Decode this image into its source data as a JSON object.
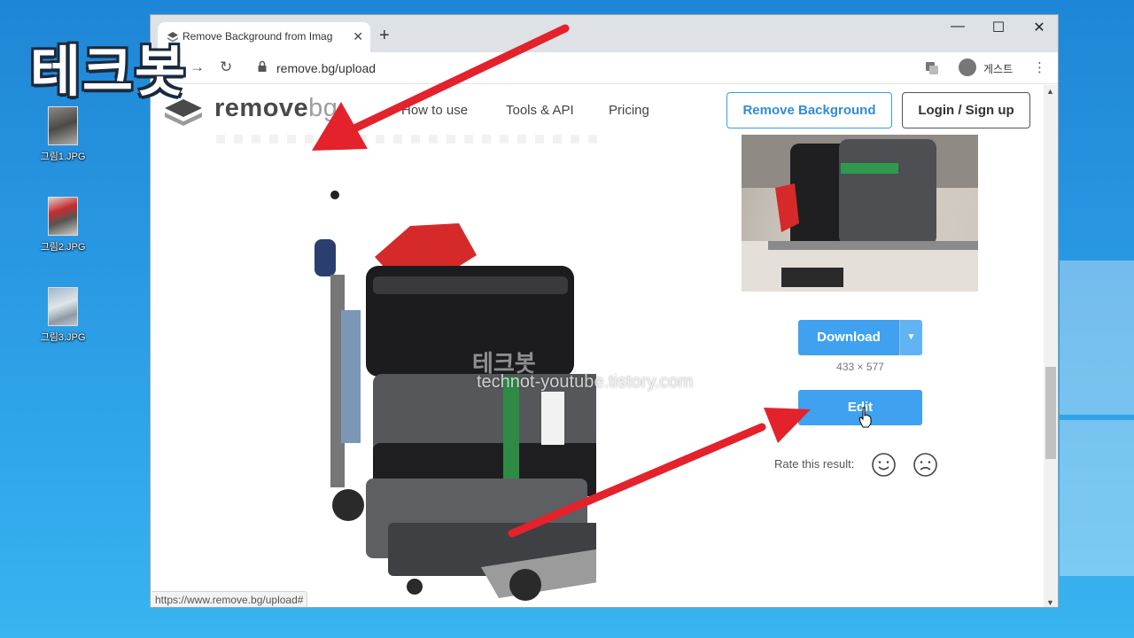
{
  "desktop": {
    "logo_text": "테크봇",
    "icons": [
      {
        "label": "그림1.JPG"
      },
      {
        "label": "그림2.JPG"
      },
      {
        "label": "그림3.JPG"
      }
    ]
  },
  "browser": {
    "tab_title": "Remove Background from Imag",
    "tab_close": "✕",
    "new_tab": "+",
    "window_controls": {
      "minimize": "—",
      "maximize": "☐",
      "close": "✕"
    },
    "url": "remove.bg/upload",
    "guest_label": "게스트",
    "status_url": "https://www.remove.bg/upload#"
  },
  "site": {
    "brand_word": "remove",
    "brand_suffix": "bg",
    "nav": [
      "How to use",
      "Tools & API",
      "Pricing"
    ],
    "remove_bg_button": "Remove Background",
    "login_button": "Login / Sign up",
    "watermark_name": "테크봇",
    "watermark_url": "technot-youtube.tistory.com",
    "download_button": "Download",
    "dimensions": "433 × 577",
    "edit_button": "Edit",
    "rate_label": "Rate this result:"
  },
  "colors": {
    "accent": "#3fa1f0",
    "arrow": "#e3222b",
    "desktop_bg": "#2a9ae4"
  }
}
